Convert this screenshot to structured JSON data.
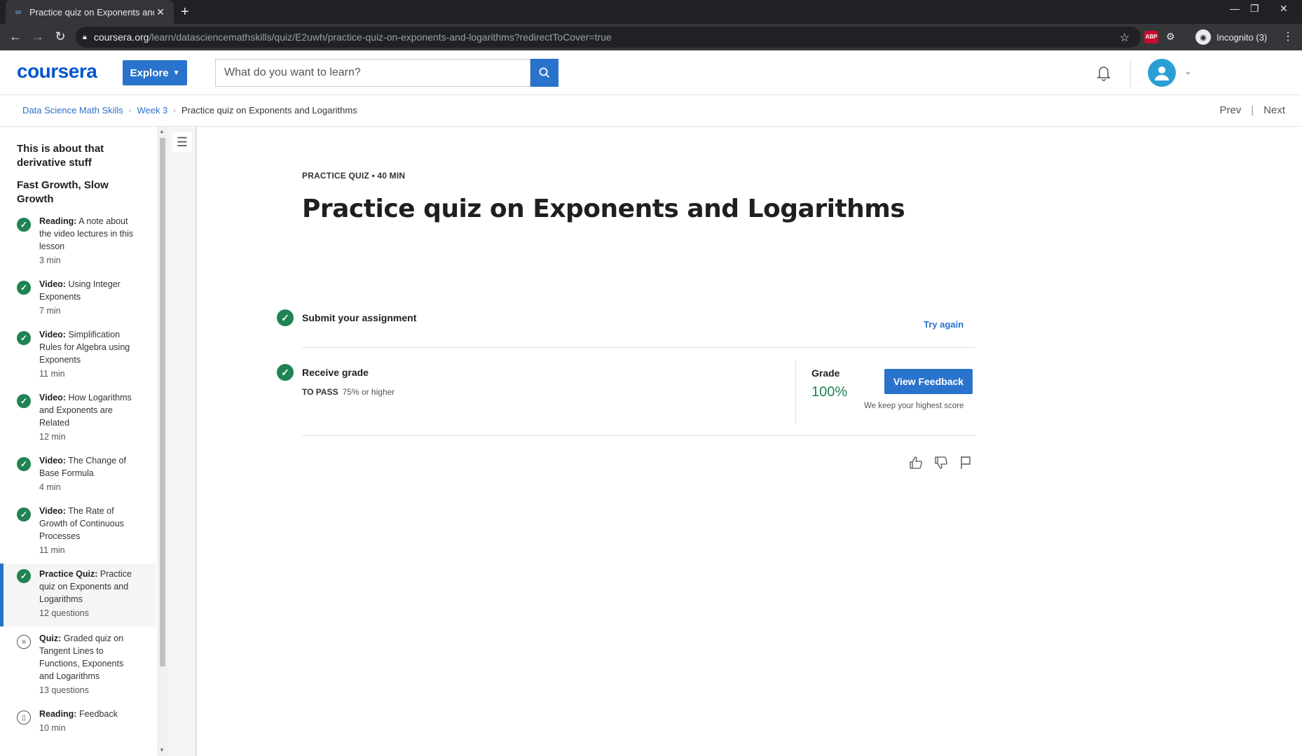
{
  "browser": {
    "tab_title": "Practice quiz on Exponents and L",
    "url_host": "coursera.org",
    "url_path": "/learn/datasciencemathskills/quiz/E2uwh/practice-quiz-on-exponents-and-logarithms?redirectToCover=true",
    "abp_label": "ABP",
    "incognito_label": "Incognito (3)"
  },
  "header": {
    "logo": "coursera",
    "explore_label": "Explore",
    "search_placeholder": "What do you want to learn?"
  },
  "breadcrumb": {
    "items": [
      "Data Science Math Skills",
      "Week 3",
      "Practice quiz on Exponents and Logarithms"
    ],
    "prev": "Prev",
    "next": "Next"
  },
  "sidebar": {
    "headings": [
      "This is about that derivative stuff",
      "Fast Growth, Slow Growth"
    ],
    "items": [
      {
        "type": "Reading:",
        "title": "A note about the video lectures in this lesson",
        "meta": "3 min",
        "status": "complete"
      },
      {
        "type": "Video:",
        "title": "Using Integer Exponents",
        "meta": "7 min",
        "status": "complete"
      },
      {
        "type": "Video:",
        "title": "Simplification Rules for Algebra using Exponents",
        "meta": "11 min",
        "status": "complete"
      },
      {
        "type": "Video:",
        "title": "How Logarithms and Exponents are Related",
        "meta": "12 min",
        "status": "complete"
      },
      {
        "type": "Video:",
        "title": "The Change of Base Formula",
        "meta": "4 min",
        "status": "complete"
      },
      {
        "type": "Video:",
        "title": "The Rate of Growth of Continuous Processes",
        "meta": "11 min",
        "status": "complete"
      },
      {
        "type": "Practice Quiz:",
        "title": "Practice quiz on Exponents and Logarithms",
        "meta": "12 questions",
        "status": "complete"
      },
      {
        "type": "Quiz:",
        "title": "Graded quiz on Tangent Lines to Functions, Exponents and Logarithms",
        "meta": "13 questions",
        "status": "quiz-icon"
      },
      {
        "type": "Reading:",
        "title": "Feedback",
        "meta": "10 min",
        "status": "reading-icon"
      }
    ]
  },
  "main": {
    "kicker": "PRACTICE QUIZ • 40 MIN",
    "title": "Practice quiz on Exponents and Logarithms",
    "submit_label": "Submit your assignment",
    "try_again": "Try again",
    "receive_label": "Receive grade",
    "to_pass_label": "TO PASS",
    "to_pass_value": "75% or higher",
    "grade_label": "Grade",
    "grade_value": "100%",
    "view_feedback": "View Feedback",
    "keep_note": "We keep your highest score"
  },
  "colors": {
    "accent": "#2a73cc",
    "success": "#1f8354",
    "brand": "#0056d2"
  }
}
